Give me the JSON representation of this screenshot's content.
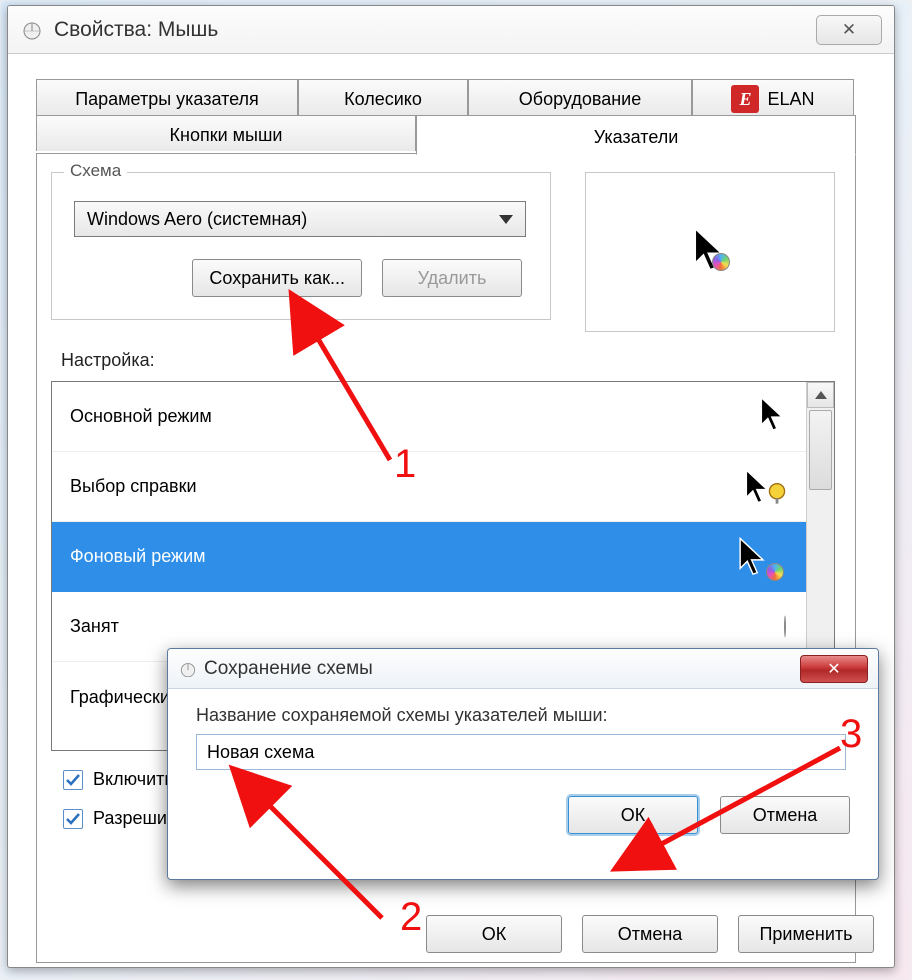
{
  "window": {
    "title": "Свойства: Мышь",
    "close_glyph": "✕"
  },
  "tabs": {
    "row1": [
      {
        "label": "Параметры указателя"
      },
      {
        "label": "Колесико"
      },
      {
        "label": "Оборудование"
      },
      {
        "label": "ELAN"
      }
    ],
    "row2": [
      {
        "label": "Кнопки мыши"
      },
      {
        "label": "Указатели"
      }
    ]
  },
  "scheme": {
    "legend": "Схема",
    "selected": "Windows Aero (системная)",
    "save_as": "Сохранить как...",
    "delete": "Удалить"
  },
  "customize_label": "Настройка:",
  "cursors": [
    {
      "label": "Основной режим",
      "icon": "arrow"
    },
    {
      "label": "Выбор справки",
      "icon": "arrow-help"
    },
    {
      "label": "Фоновый режим",
      "icon": "arrow-busy",
      "selected": true
    },
    {
      "label": "Занят",
      "icon": "busy"
    },
    {
      "label": "Графически",
      "icon": "cross",
      "truncated": true
    }
  ],
  "checkboxes": {
    "enable_shadow": "Включить",
    "allow_themes": "Разреши"
  },
  "buttons": {
    "ok": "ОК",
    "cancel": "Отмена",
    "apply": "Применить"
  },
  "dialog": {
    "title": "Сохранение схемы",
    "prompt": "Название сохраняемой схемы указателей мыши:",
    "value": "Новая схема",
    "ok": "ОК",
    "cancel": "Отмена",
    "close_glyph": "✕"
  },
  "annotations": {
    "one": "1",
    "two": "2",
    "three": "3"
  },
  "colors": {
    "accent": "#2f8fe8",
    "annotation": "#f01010"
  }
}
